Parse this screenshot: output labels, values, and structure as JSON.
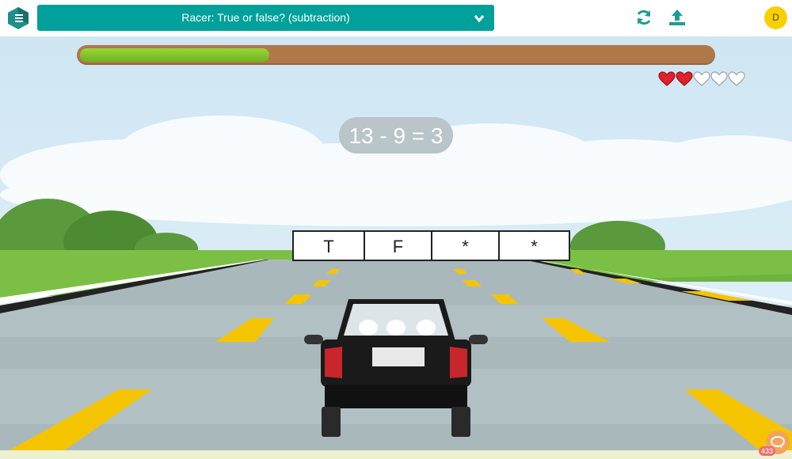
{
  "header": {
    "activity_title": "Racer: True or false? (subtraction)",
    "user_initial": "D",
    "icons": [
      "logo-icon",
      "chevron-down-icon",
      "refresh-icon",
      "upload-icon"
    ]
  },
  "game": {
    "progress_fraction": 0.3,
    "lives_total": 5,
    "lives_remaining": 2,
    "question": "13 - 9 = 3",
    "answers": [
      "T",
      "F",
      "*",
      "*"
    ]
  },
  "chat": {
    "badge_count": "433"
  },
  "colors": {
    "accent": "#00a19a",
    "progress_track": "#b07848",
    "progress_fill": "#7ec326",
    "heart_full": "#e0202a",
    "avatar": "#f7d000",
    "lane_marks": "#f5c400"
  }
}
